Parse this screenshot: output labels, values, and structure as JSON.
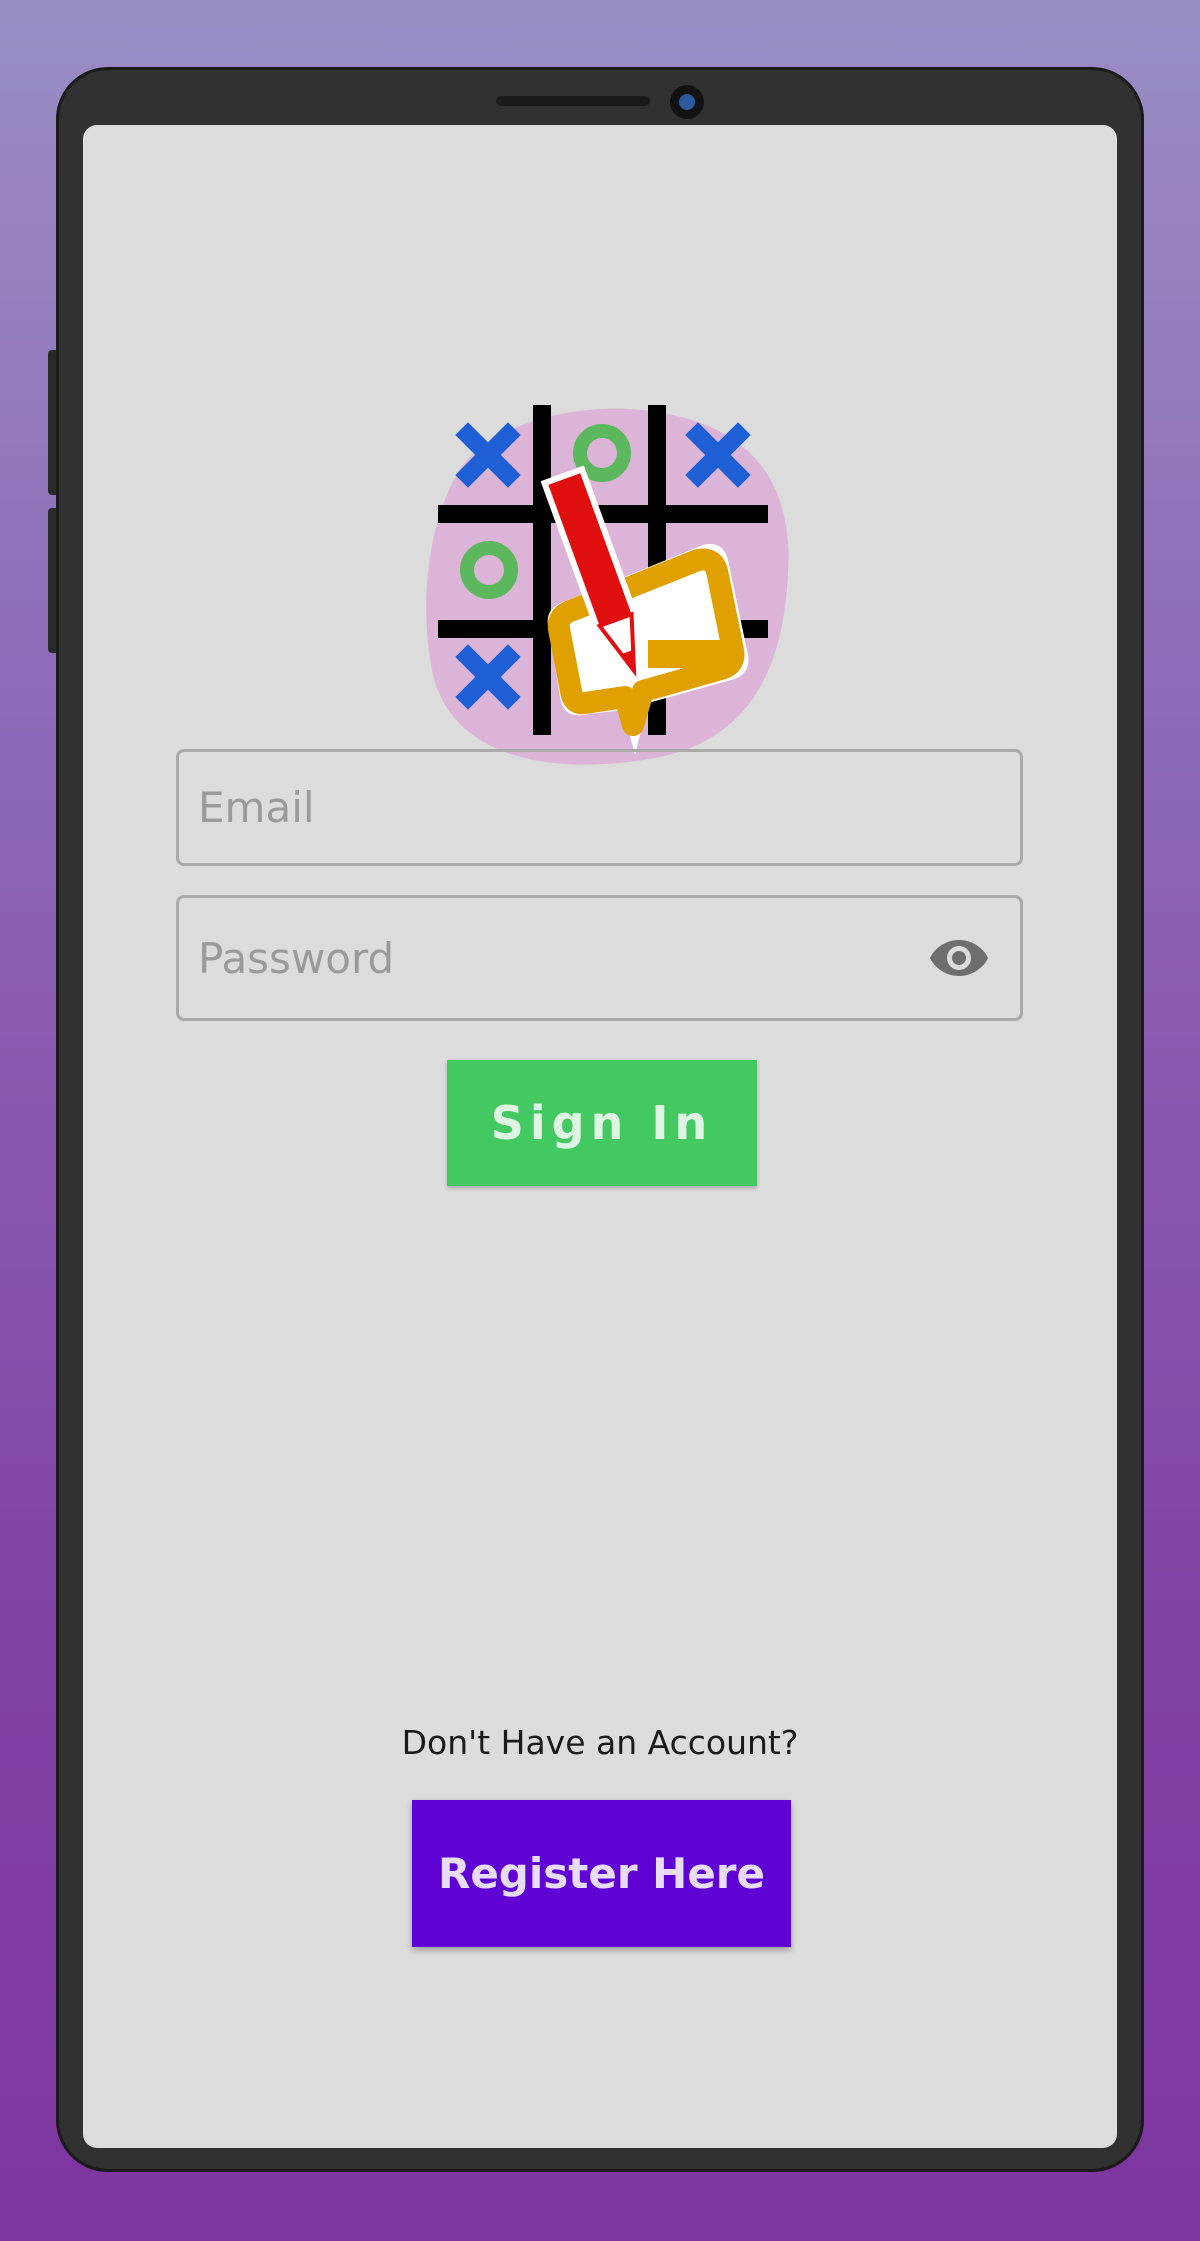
{
  "app": {
    "logo_icon": "tic-tac-toe-pencil-logo-icon"
  },
  "login": {
    "email_placeholder": "Email",
    "email_value": "",
    "password_placeholder": "Password",
    "password_value": "",
    "password_visibility_icon": "eye-icon",
    "signin_label": "Sign In"
  },
  "register": {
    "prompt": "Don't Have an Account?",
    "button_label": "Register Here"
  },
  "colors": {
    "background_top": "#9a8ec4",
    "background_bottom": "#7e36a0",
    "screen": "#dcdcdc",
    "signin_button": "#43c862",
    "register_button": "#5e03d4",
    "logo_blob": "#dcb4d8",
    "x_mark": "#1f5fd6",
    "o_mark": "#5cb85c",
    "pencil": "#e01010",
    "chat_bubble": "#e0a000"
  }
}
